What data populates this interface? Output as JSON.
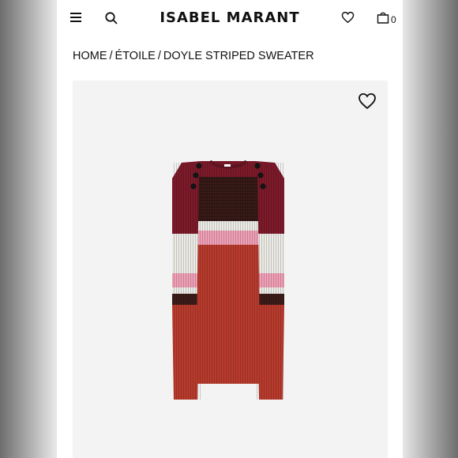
{
  "header": {
    "brand": "ISABEL MARANT",
    "bag_count": "0",
    "icons": [
      "menu-icon",
      "search-icon",
      "heart-icon",
      "shopping-bag-icon"
    ]
  },
  "breadcrumb": {
    "items": [
      "HOME",
      "ÉTOILE",
      "DOYLE STRIPED SWEATER"
    ],
    "separator": "/"
  },
  "product": {
    "image_icon": "sweater",
    "wishlist_icon": "heart-icon",
    "colors": {
      "burgundy": "#7d1a2a",
      "dark_brown": "#3b1c19",
      "pink": "#ef9fb6",
      "cream": "#ecebe6",
      "rust": "#b83b2d"
    }
  }
}
